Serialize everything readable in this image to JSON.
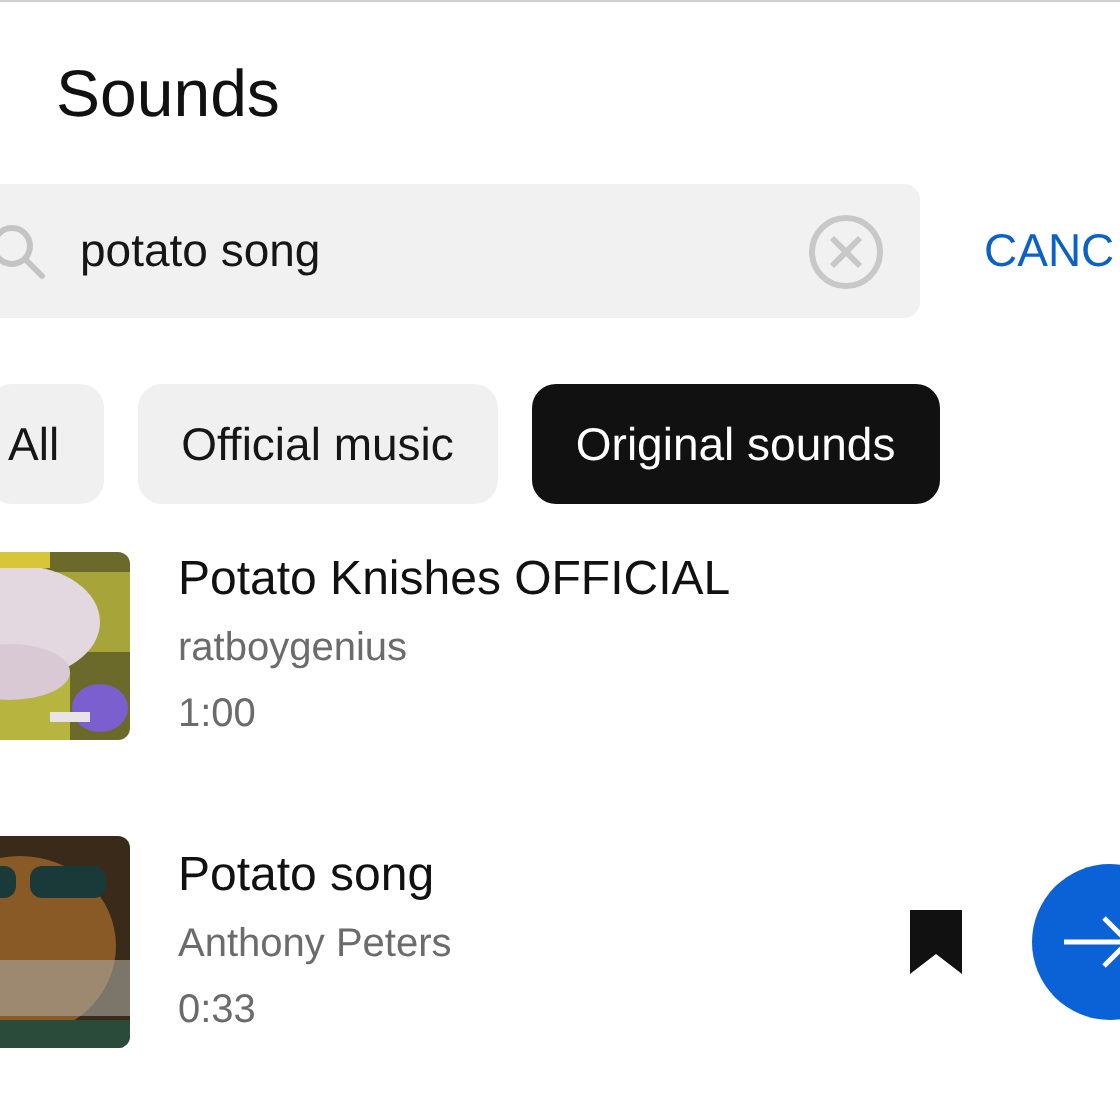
{
  "title": "Sounds",
  "search": {
    "value": "potato song",
    "cancel": "CANC"
  },
  "chips": [
    {
      "label": "All",
      "selected": false
    },
    {
      "label": "Official music",
      "selected": false
    },
    {
      "label": "Original sounds",
      "selected": true
    }
  ],
  "results": [
    {
      "title": "Potato Knishes OFFICIAL",
      "author": "ratboygenius",
      "duration": "1:00",
      "bookmarked": false,
      "kind": "picture"
    },
    {
      "title": "Potato song",
      "author": "Anthony Peters",
      "duration": "0:33",
      "bookmarked": true,
      "kind": "picture"
    }
  ]
}
